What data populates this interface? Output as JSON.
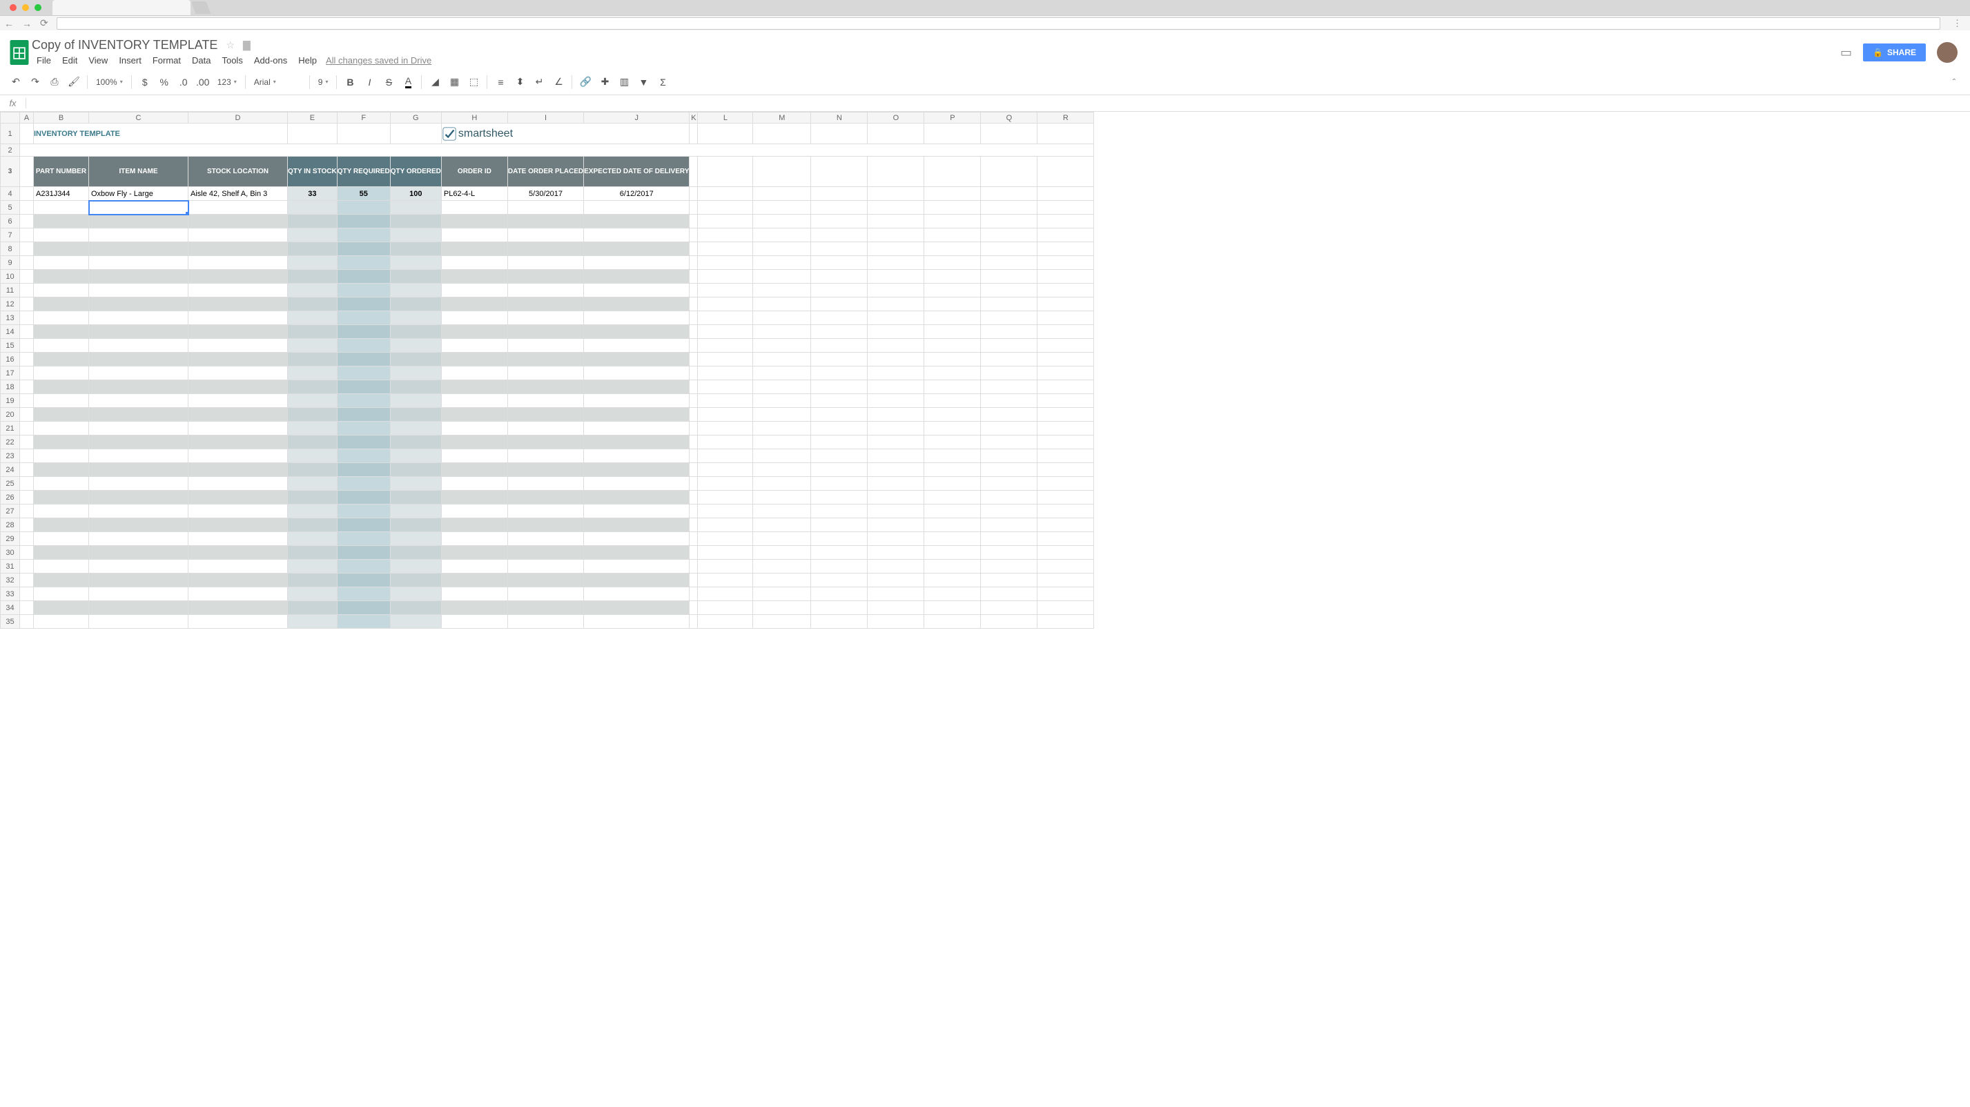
{
  "browser": {
    "url": ""
  },
  "doc": {
    "title": "Copy of INVENTORY TEMPLATE",
    "save_status": "All changes saved in Drive"
  },
  "menus": [
    "File",
    "Edit",
    "View",
    "Insert",
    "Format",
    "Data",
    "Tools",
    "Add-ons",
    "Help"
  ],
  "toolbar": {
    "zoom": "100%",
    "currency": "$",
    "percent": "%",
    "dec_less": ".0",
    "dec_more": ".00",
    "num_format": "123",
    "font": "Arial",
    "font_size": "9"
  },
  "share_label": "SHARE",
  "formula_bar": {
    "fx": "fx",
    "value": ""
  },
  "columns": [
    "A",
    "B",
    "C",
    "D",
    "E",
    "F",
    "G",
    "H",
    "I",
    "J",
    "K",
    "L",
    "M",
    "N",
    "O",
    "P",
    "Q",
    "R"
  ],
  "template": {
    "title": "INVENTORY TEMPLATE",
    "brand": "smartsheet",
    "headers": {
      "part_number": "PART NUMBER",
      "item_name": "ITEM NAME",
      "stock_location": "STOCK LOCATION",
      "qty_in_stock": "QTY IN STOCK",
      "qty_required": "QTY REQUIRED",
      "qty_ordered": "QTY ORDERED",
      "order_id": "ORDER ID",
      "date_order_placed": "DATE ORDER PLACED",
      "expected_delivery": "EXPECTED DATE OF DELIVERY"
    },
    "rows": [
      {
        "part_number": "A231J344",
        "item_name": "Oxbow Fly - Large",
        "stock_location": "Aisle 42, Shelf A, Bin 3",
        "qty_in_stock": "33",
        "qty_required": "55",
        "qty_ordered": "100",
        "order_id": "PL62-4-L",
        "date_order_placed": "5/30/2017",
        "expected_delivery": "6/12/2017"
      }
    ]
  },
  "selected_cell": "C5",
  "chart_data": {
    "type": "table",
    "title": "INVENTORY TEMPLATE",
    "columns": [
      "PART NUMBER",
      "ITEM NAME",
      "STOCK LOCATION",
      "QTY IN STOCK",
      "QTY REQUIRED",
      "QTY ORDERED",
      "ORDER ID",
      "DATE ORDER PLACED",
      "EXPECTED DATE OF DELIVERY"
    ],
    "rows": [
      [
        "A231J344",
        "Oxbow Fly - Large",
        "Aisle 42, Shelf A, Bin 3",
        33,
        55,
        100,
        "PL62-4-L",
        "5/30/2017",
        "6/12/2017"
      ]
    ]
  }
}
